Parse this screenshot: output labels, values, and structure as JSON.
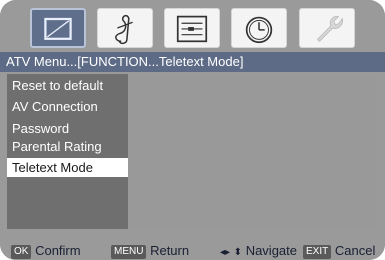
{
  "icons": [
    {
      "name": "picture-icon",
      "state": "active"
    },
    {
      "name": "sound-icon",
      "state": "inactive"
    },
    {
      "name": "channel-icon",
      "state": "inactive"
    },
    {
      "name": "timer-icon",
      "state": "inactive"
    },
    {
      "name": "function-icon",
      "state": "inactive"
    }
  ],
  "breadcrumb": "ATV Menu...[FUNCTION...Teletext Mode]",
  "menu": {
    "items": [
      {
        "label": "Reset to default"
      },
      {
        "label": "AV Connection"
      },
      {
        "label": "Password"
      },
      {
        "label": "Parental Rating"
      },
      {
        "label": "Teletext Mode"
      }
    ],
    "selected_label": "Teletext Mode"
  },
  "hints": {
    "ok_key": "OK",
    "ok_label": "Confirm",
    "menu_key": "MENU",
    "menu_label": "Return",
    "navigate_label": "Navigate",
    "exit_key": "EXIT",
    "exit_label": "Cancel"
  },
  "colors": {
    "breadcrumb_bg": "#5d6b86",
    "menu_bg": "#6f6f6f",
    "selected_bg": "#ffffff",
    "screen_bg": "#9a9a9a"
  }
}
